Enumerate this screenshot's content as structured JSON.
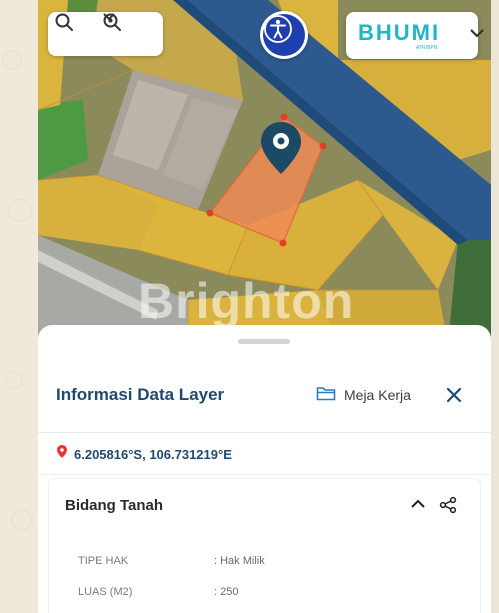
{
  "map": {
    "watermark": "Brighton",
    "search_icon": "search-icon",
    "zoom_icon": "zoom-icon",
    "accessibility_icon": "accessibility-icon",
    "brand_logo": "BHUMI",
    "brand_sub": "ATR/BPN",
    "colors": {
      "parcel_yellow": "#e0b43a",
      "selected_parcel": "#f08c55",
      "road_blue": "#2d5a8e",
      "pin": "#1c4966",
      "accent": "#1e3fae"
    }
  },
  "panel": {
    "title": "Informasi Data Layer",
    "meja_kerja_label": "Meja Kerja",
    "coordinates": "6.205816°S, 106.731219°E",
    "section_title": "Bidang Tanah",
    "attributes": [
      {
        "label": "TIPE HAK",
        "value": ": Hak Milik"
      },
      {
        "label": "LUAS (M2)",
        "value": ": 250"
      }
    ]
  }
}
